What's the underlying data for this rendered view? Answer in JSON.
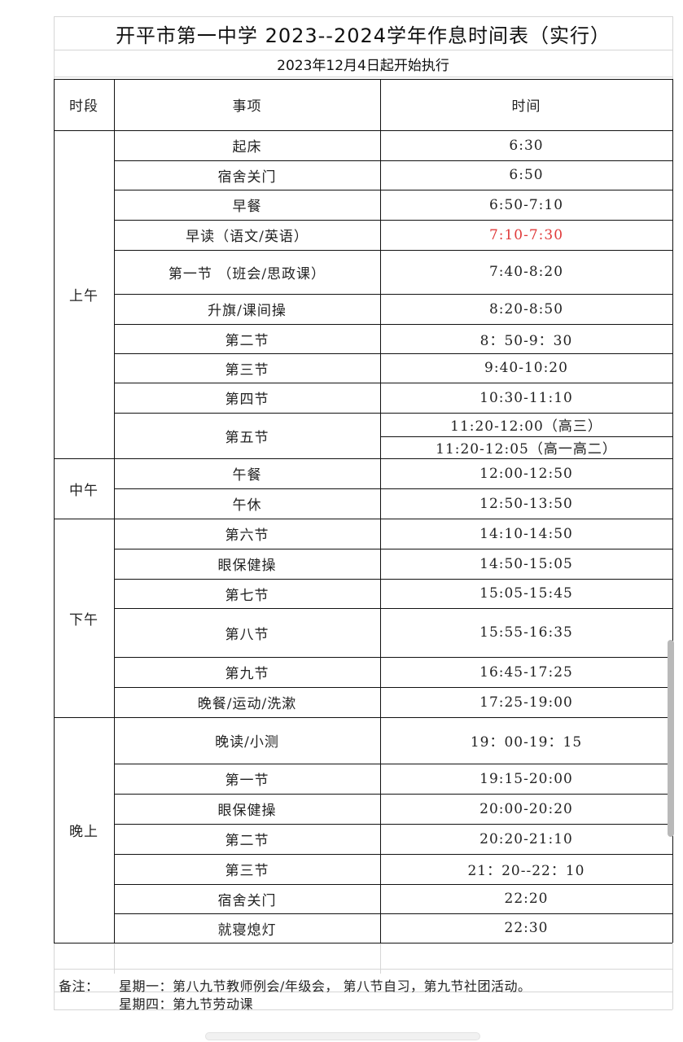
{
  "title": "开平市第一中学 2023--2024学年作息时间表（实行）",
  "subtitle": "2023年12月4日起开始执行",
  "headers": {
    "period": "时段",
    "item": "事项",
    "time": "时间"
  },
  "periods": {
    "morning": "上午",
    "noon": "中午",
    "afternoon": "下午",
    "evening": "晚上"
  },
  "rows": [
    {
      "item": "起床",
      "time": "6:30"
    },
    {
      "item": "宿舍关门",
      "time": "6:50"
    },
    {
      "item": "早餐",
      "time": "6:50-7:10"
    },
    {
      "item": "早读（语文/英语）",
      "time": "7:10-7:30"
    },
    {
      "item": "第一节  （班会/思政课）",
      "time": "7:40-8:20"
    },
    {
      "item": "升旗/课间操",
      "time": "8:20-8:50"
    },
    {
      "item": "第二节",
      "time": "8：50-9：30"
    },
    {
      "item": "第三节",
      "time": "9:40-10:20"
    },
    {
      "item": "第四节",
      "time": "10:30-11:10"
    },
    {
      "item": "第五节",
      "time": "11:20-12:00（高三）",
      "time2": "11:20-12:05（高一高二）"
    },
    {
      "item": "午餐",
      "time": "12:00-12:50"
    },
    {
      "item": "午休",
      "time": "12:50-13:50"
    },
    {
      "item": "第六节",
      "time": "14:10-14:50"
    },
    {
      "item": "眼保健操",
      "time": "14:50-15:05"
    },
    {
      "item": "第七节",
      "time": "15:05-15:45"
    },
    {
      "item": "第八节",
      "time": "15:55-16:35"
    },
    {
      "item": "第九节",
      "time": "16:45-17:25"
    },
    {
      "item": "晚餐/运动/洗漱",
      "time": "17:25-19:00"
    },
    {
      "item": "晚读/小测",
      "time": "19：00-19：15"
    },
    {
      "item": "第一节",
      "time": "19:15-20:00"
    },
    {
      "item": "眼保健操",
      "time": "20:00-20:20"
    },
    {
      "item": "第二节",
      "time": "20:20-21:10"
    },
    {
      "item": "第三节",
      "time": "21：20--22：10"
    },
    {
      "item": "宿舍关门",
      "time": "22:20"
    },
    {
      "item": "就寝熄灯",
      "time": "22:30"
    }
  ],
  "highlight_color": "#e03a3a",
  "notes": {
    "label": "备注：",
    "line1": "星期一：第八九节教师例会/年级会，  第八节自习，第九节社团活动。",
    "line2": "星期四：第九节劳动课"
  }
}
